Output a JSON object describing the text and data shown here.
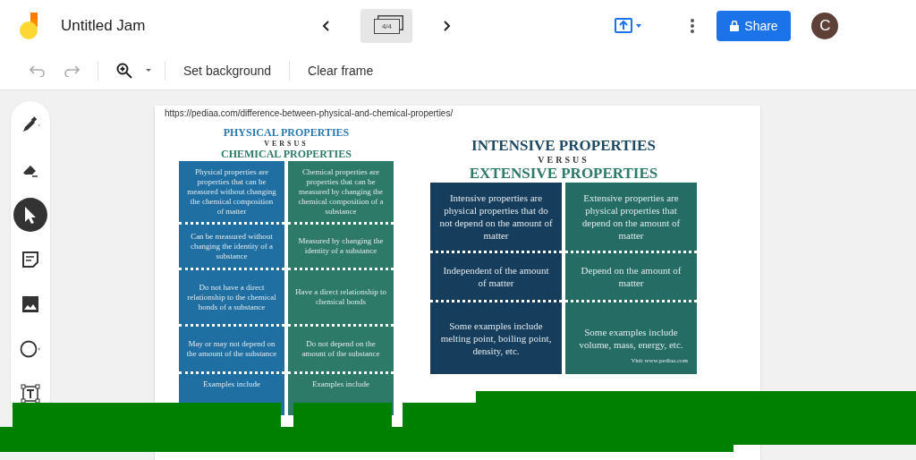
{
  "app": {
    "title": "Untitled Jam",
    "frame_counter": "4/4",
    "share": "Share",
    "avatar": "C"
  },
  "toolbar": {
    "items": [
      "Set background",
      "Clear frame"
    ]
  },
  "tools": [
    {
      "kind": "pen",
      "selected": false
    },
    {
      "kind": "eraser",
      "selected": false
    },
    {
      "kind": "select",
      "selected": true
    },
    {
      "kind": "note",
      "selected": false
    },
    {
      "kind": "image",
      "selected": false
    },
    {
      "kind": "circle",
      "selected": false
    },
    {
      "kind": "textbox",
      "selected": false
    }
  ],
  "frame": {
    "url": "https://pediaa.com/difference-between-physical-and-chemical-properties/",
    "left": {
      "title_a": "PHYSICAL PROPERTIES",
      "versus": "VERSUS",
      "title_b": "CHEMICAL PROPERTIES",
      "rows": [
        [
          "Physical properties are properties that can be measured without changing the chemical composition of matter",
          "Chemical properties are properties that can be measured by changing the chemical composition of a substance"
        ],
        [
          "Can be measured without changing the identity of a substance",
          "Measured by changing the identity of a substance"
        ],
        [
          "Do not have a direct relationship to the chemical bonds of a substance",
          "Have a direct relationship to chemical bonds"
        ],
        [
          "May or may not depend on the amount of the substance",
          "Do not depend on the amount of the substance"
        ],
        [
          "Examples include",
          "Examples include"
        ]
      ]
    },
    "right": {
      "title_a": "INTENSIVE PROPERTIES",
      "versus": "VERSUS",
      "title_b": "EXTENSIVE PROPERTIES",
      "rows": [
        [
          "Intensive properties are physical properties that do not depend on the amount of matter",
          "Extensive properties are physical properties that depend on the amount of matter"
        ],
        [
          "Independent of the amount of matter",
          "Depend on the amount of matter"
        ],
        [
          "Some examples include melting point, boiling point, density, etc.",
          "Some examples include volume, mass, energy, etc."
        ]
      ],
      "credit": "Visit www.pediaa.com"
    }
  }
}
